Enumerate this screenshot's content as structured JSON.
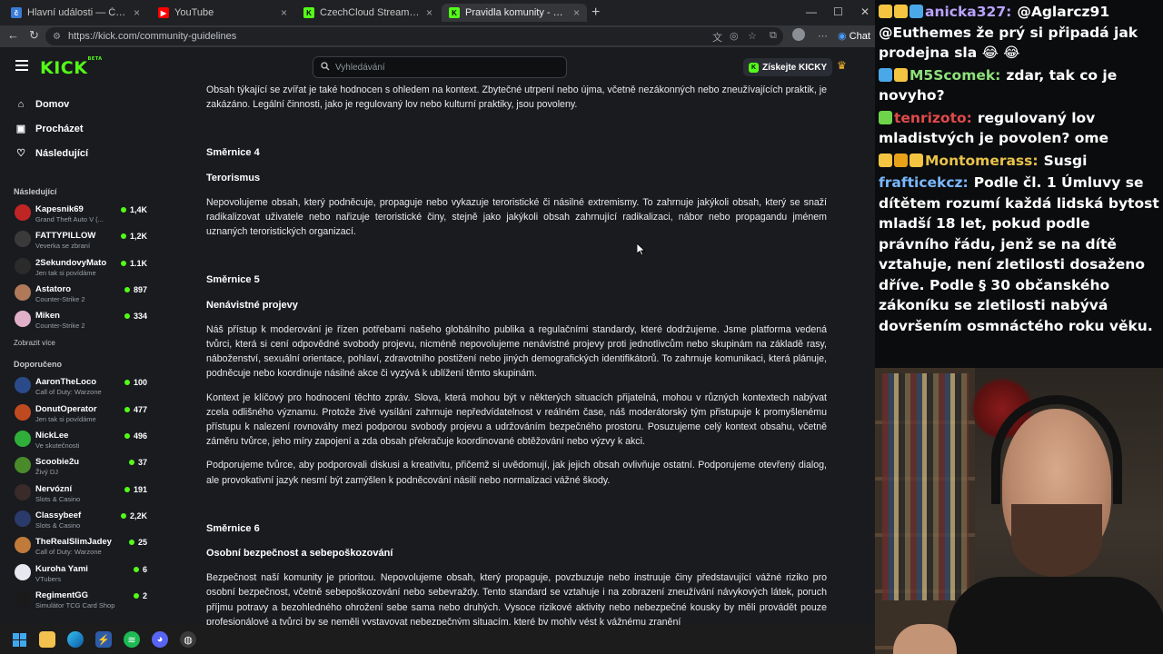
{
  "browser": {
    "tabs": [
      {
        "title": "Hlavní události — ČT24 — Česká t",
        "favicon": "ct24",
        "active": false
      },
      {
        "title": "YouTube",
        "favicon": "youtube",
        "active": false
      },
      {
        "title": "CzechCloud Stream - Watch Live o",
        "favicon": "kick",
        "active": false
      },
      {
        "title": "Pravidla komunity - Kick Streaming",
        "favicon": "kick",
        "active": true
      }
    ],
    "url": "https://kick.com/community-guidelines",
    "chat_label": "Chat"
  },
  "kick": {
    "logo": "KICK",
    "logo_beta": "BETA",
    "search_placeholder": "Vyhledávání",
    "get_kicky_label": "Získejte KICKY"
  },
  "sidebar": {
    "nav": [
      {
        "label": "Domov",
        "icon": "home-icon"
      },
      {
        "label": "Procházet",
        "icon": "browse-icon"
      },
      {
        "label": "Následující",
        "icon": "heart-icon"
      }
    ],
    "following_title": "Následující",
    "following": [
      {
        "name": "Kapesnik69",
        "category": "Grand Theft Auto V (...",
        "viewers": "1,4K",
        "color": "#c02525"
      },
      {
        "name": "FATTYPILLOW",
        "category": "Veverka se zbraní",
        "viewers": "1,2K",
        "color": "#3a3a3a"
      },
      {
        "name": "2SekundovyMato",
        "category": "Jen tak si povídáme",
        "viewers": "1.1K",
        "color": "#2b2b2b"
      },
      {
        "name": "Astatoro",
        "category": "Counter-Strike 2",
        "viewers": "897",
        "color": "#b07a5a"
      },
      {
        "name": "Miken",
        "category": "Counter-Strike 2",
        "viewers": "334",
        "color": "#e0b0c8"
      }
    ],
    "show_more": "Zobrazit více",
    "recommended_title": "Doporučeno",
    "recommended": [
      {
        "name": "AaronTheLoco",
        "category": "Call of Duty: Warzone",
        "viewers": "100",
        "color": "#2a4a8a"
      },
      {
        "name": "DonutOperator",
        "category": "Jen tak si povídáme",
        "viewers": "477",
        "color": "#c04a20"
      },
      {
        "name": "NickLee",
        "category": "Ve skutečnosti",
        "viewers": "496",
        "color": "#2fae3a"
      },
      {
        "name": "Scoobie2u",
        "category": "Živý DJ",
        "viewers": "37",
        "color": "#4a8a2a"
      },
      {
        "name": "Nervózní",
        "category": "Slots & Casino",
        "viewers": "191",
        "color": "#3a2a2a"
      },
      {
        "name": "Classybeef",
        "category": "Slots & Casino",
        "viewers": "2,2K",
        "color": "#2a3a6a"
      },
      {
        "name": "TheRealSlimJadey",
        "category": "Call of Duty: Warzone",
        "viewers": "25",
        "color": "#c07a3a"
      },
      {
        "name": "Kuroha Yami",
        "category": "VTubers",
        "viewers": "6",
        "color": "#e8e8f0"
      },
      {
        "name": "RegimentGG",
        "category": "Simulátor TCG Card Shop",
        "viewers": "2",
        "color": "#1a1a1a"
      }
    ]
  },
  "content": {
    "intro": "Obsah týkající se zvířat je také hodnocen s ohledem na kontext. Zbytečné utrpení nebo újma, včetně nezákonných nebo zneužívajících praktik, je zakázáno. Legální činnosti, jako je regulovaný lov nebo kulturní praktiky, jsou povoleny.",
    "sections": [
      {
        "title": "Směrnice 4",
        "subtitle": "Terorismus",
        "paragraphs": [
          "Nepovolujeme obsah, který podněcuje, propaguje nebo vykazuje teroristické či násilné extremismy. To zahrnuje jakýkoli obsah, který se snaží radikalizovat uživatele nebo nařizuje teroristické činy, stejně jako jakýkoli obsah zahrnující radikalizaci, nábor nebo propagandu jménem uznaných teroristických organizací."
        ]
      },
      {
        "title": "Směrnice 5",
        "subtitle": "Nenávistné projevy",
        "paragraphs": [
          "Náš přístup k moderování je řízen potřebami našeho globálního publika a regulačními standardy, které dodržujeme. Jsme platforma vedená tvůrci, která si cení odpovědné svobody projevu, nicméně nepovolujeme nenávistné projevy proti jednotlivcům nebo skupinám na základě rasy, náboženství, sexuální orientace, pohlaví, zdravotního postižení nebo jiných demografických identifikátorů. To zahrnuje komunikaci, která plánuje, podněcuje nebo koordinuje násilné akce či vyzývá k ublížení těmto skupinám.",
          "Kontext je klíčový pro hodnocení těchto zpráv. Slova, která mohou být v některých situacích přijatelná, mohou v různých kontextech nabývat zcela odlišného významu. Protože živé vysílání zahrnuje nepředvídatelnost v reálném čase, náš moderátorský tým přistupuje k promyšlenému přístupu k nalezení rovnováhy mezi podporou svobody projevu a udržováním bezpečného prostoru. Posuzujeme celý kontext obsahu, včetně záměru tvůrce, jeho míry zapojení a zda obsah překračuje koordinované obtěžování nebo výzvy k akci.",
          "Podporujeme tvůrce, aby podporovali diskusi a kreativitu, přičemž si uvědomují, jak jejich obsah ovlivňuje ostatní. Podporujeme otevřený dialog, ale provokativní jazyk nesmí být zamýšlen k podněcování násilí nebo normalizaci vážné škody."
        ]
      },
      {
        "title": "Směrnice 6",
        "subtitle": "Osobní bezpečnost a sebepoškozování",
        "paragraphs": [
          "Bezpečnost naší komunity je prioritou. Nepovolujeme obsah, který propaguje, povzbuzuje nebo instruuje činy představující vážné riziko pro osobní bezpečnost, včetně sebepoškozování nebo sebevraždy. Tento standard se vztahuje i na zobrazení zneužívání návykových látek, poruch příjmu potravy a bezohledného ohrožení sebe sama nebo druhých. Vysoce rizikové aktivity nebo nebezpečné kousky by měli provádět pouze profesionálové a tvůrci by se neměli vystavovat nebezpečným situacím, které by mohly vést k vážnému zranění"
        ]
      }
    ]
  },
  "chat": [
    {
      "user": "anicka327:",
      "user_color": "#b9a3ff",
      "badges": [
        "#f5c542",
        "#f5c542",
        "#4aa8e8"
      ],
      "message": "@Aglarcz91 @Euthemes že prý si připadá jak prodejna sla 😂 😂"
    },
    {
      "user": "M5Scomek:",
      "user_color": "#8ee07a",
      "badges": [
        "#4aa8e8",
        "#f5c542"
      ],
      "message": "zdar, tak co je novyho?"
    },
    {
      "user": "tenrizoto:",
      "user_color": "#e04a4a",
      "badges": [
        "#6ed44a"
      ],
      "message": "regulovaný lov mladistvých je povolen? ome"
    },
    {
      "user": "Montomerass:",
      "user_color": "#e8c24a",
      "badges": [
        "#f5c542",
        "#e8a21a",
        "#f5c542"
      ],
      "message": "Susgi"
    },
    {
      "user": "frafticekcz:",
      "user_color": "#7ab8ff",
      "badges": [],
      "message": "Podle čl. 1 Úmluvy se dítětem rozumí každá lidská bytost mladší 18 let, pokud podle právního řádu, jenž se na dítě vztahuje, není zletilosti dosaženo dříve. Podle § 30 občanského zákoníku se zletilosti nabývá dovršením osmnáctého roku věku."
    }
  ]
}
